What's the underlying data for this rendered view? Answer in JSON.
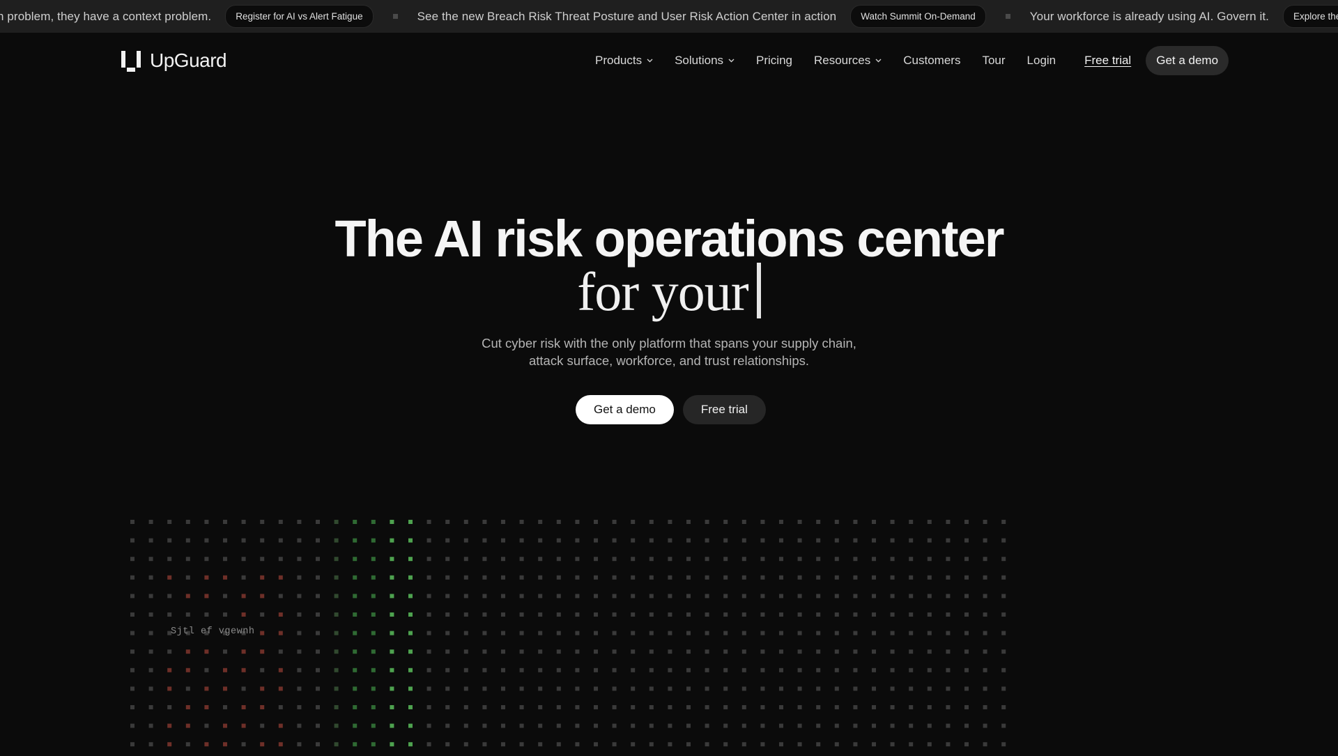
{
  "announcement": {
    "items": [
      {
        "text": "n problem, they have a context problem.",
        "pill": "Register for AI vs Alert Fatigue"
      },
      {
        "text": "See the new Breach Risk Threat Posture and User Risk Action Center in action",
        "pill": "Watch Summit On-Demand"
      },
      {
        "text": "Your workforce is already using AI. Govern it.",
        "pill": "Explore the AI Secu"
      }
    ]
  },
  "brand": {
    "name": "UpGuard"
  },
  "nav": {
    "items": [
      {
        "label": "Products",
        "dropdown": true
      },
      {
        "label": "Solutions",
        "dropdown": true
      },
      {
        "label": "Pricing",
        "dropdown": false
      },
      {
        "label": "Resources",
        "dropdown": true
      },
      {
        "label": "Customers",
        "dropdown": false
      },
      {
        "label": "Tour",
        "dropdown": false
      },
      {
        "label": "Login",
        "dropdown": false
      }
    ],
    "free_trial": "Free trial",
    "get_demo": "Get a demo"
  },
  "hero": {
    "title": "The AI risk operations center",
    "subtitle": "for your",
    "description_line1": "Cut cyber risk with the only platform that spans your supply chain,",
    "description_line2": "attack surface, workforce, and trust relationships.",
    "cta_primary": "Get a demo",
    "cta_secondary": "Free trial"
  },
  "visual": {
    "label": "Sjtl ef vgewnh",
    "colors": {
      "dot": "#3a3a3a",
      "red": "#6e2f28",
      "green": "#2f6a33",
      "green_bright": "#4ea24f"
    }
  },
  "colors": {
    "background": "#0b0b0b",
    "announce_bg": "#1f1f1f",
    "accent": "#ffffff"
  }
}
